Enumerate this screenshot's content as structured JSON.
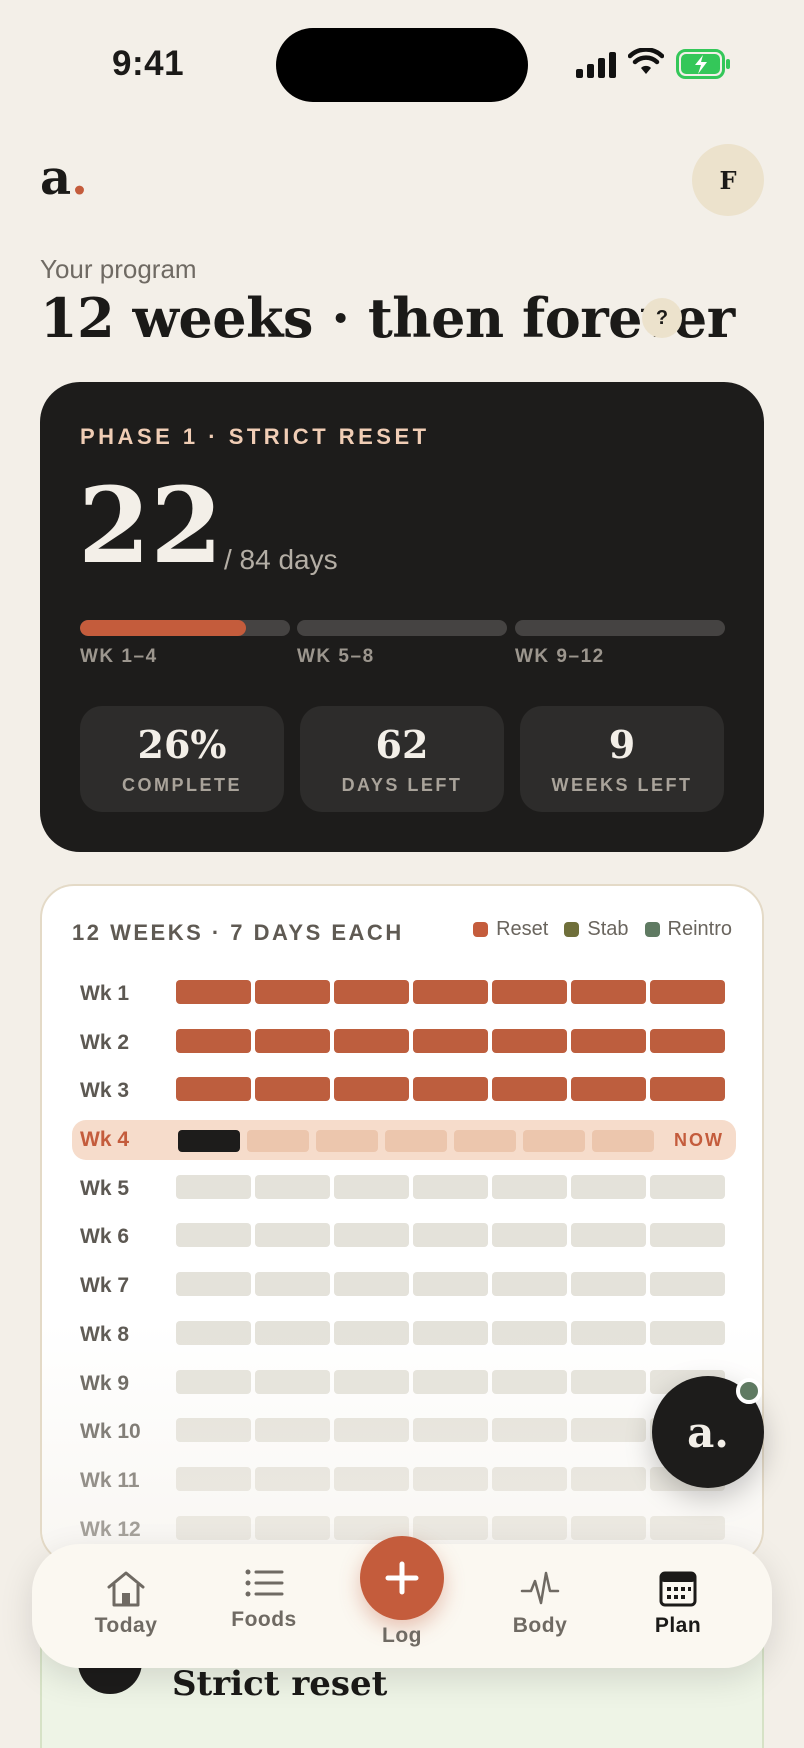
{
  "status": {
    "time": "9:41"
  },
  "header": {
    "logo_letter": "a",
    "logo_dot": ".",
    "avatar_initial": "F"
  },
  "program": {
    "kicker": "Your program",
    "title": "12 weeks · then forever",
    "help_label": "?"
  },
  "phase_card": {
    "phase_label": "PHASE 1 · STRICT RESET",
    "day": "22",
    "total": "/ 84 days",
    "segments": [
      {
        "label": "WK 1–4",
        "progress": 0.79
      },
      {
        "label": "WK 5–8",
        "progress": 0
      },
      {
        "label": "WK 9–12",
        "progress": 0
      }
    ],
    "stats": [
      {
        "value": "26%",
        "label": "COMPLETE"
      },
      {
        "value": "62",
        "label": "DAYS LEFT"
      },
      {
        "value": "9",
        "label": "WEEKS LEFT"
      }
    ]
  },
  "weeks_card": {
    "heading": "12 WEEKS · 7 DAYS EACH",
    "legend": [
      {
        "label": "Reset",
        "color": "#c45c3c"
      },
      {
        "label": "Stab",
        "color": "#6f6f3a"
      },
      {
        "label": "Reintro",
        "color": "#5f7a62"
      }
    ],
    "now_label": "NOW",
    "weeks": [
      {
        "label": "Wk 1",
        "status": "done"
      },
      {
        "label": "Wk 2",
        "status": "done"
      },
      {
        "label": "Wk 3",
        "status": "done"
      },
      {
        "label": "Wk 4",
        "status": "current"
      },
      {
        "label": "Wk 5",
        "status": "upcoming"
      },
      {
        "label": "Wk 6",
        "status": "upcoming"
      },
      {
        "label": "Wk 7",
        "status": "upcoming"
      },
      {
        "label": "Wk 8",
        "status": "upcoming"
      },
      {
        "label": "Wk 9",
        "status": "upcoming"
      },
      {
        "label": "Wk 10",
        "status": "upcoming"
      },
      {
        "label": "Wk 11",
        "status": "upcoming"
      },
      {
        "label": "Wk 12",
        "status": "upcoming"
      }
    ]
  },
  "next_card": {
    "title": "Strict reset"
  },
  "assistant": {
    "label": "a."
  },
  "tabbar": {
    "tabs": [
      {
        "label": "Today",
        "icon": "home-icon"
      },
      {
        "label": "Foods",
        "icon": "list-icon"
      },
      {
        "label": "Log",
        "icon": "plus-icon"
      },
      {
        "label": "Body",
        "icon": "pulse-icon"
      },
      {
        "label": "Plan",
        "icon": "calendar-icon",
        "active": true
      }
    ]
  }
}
